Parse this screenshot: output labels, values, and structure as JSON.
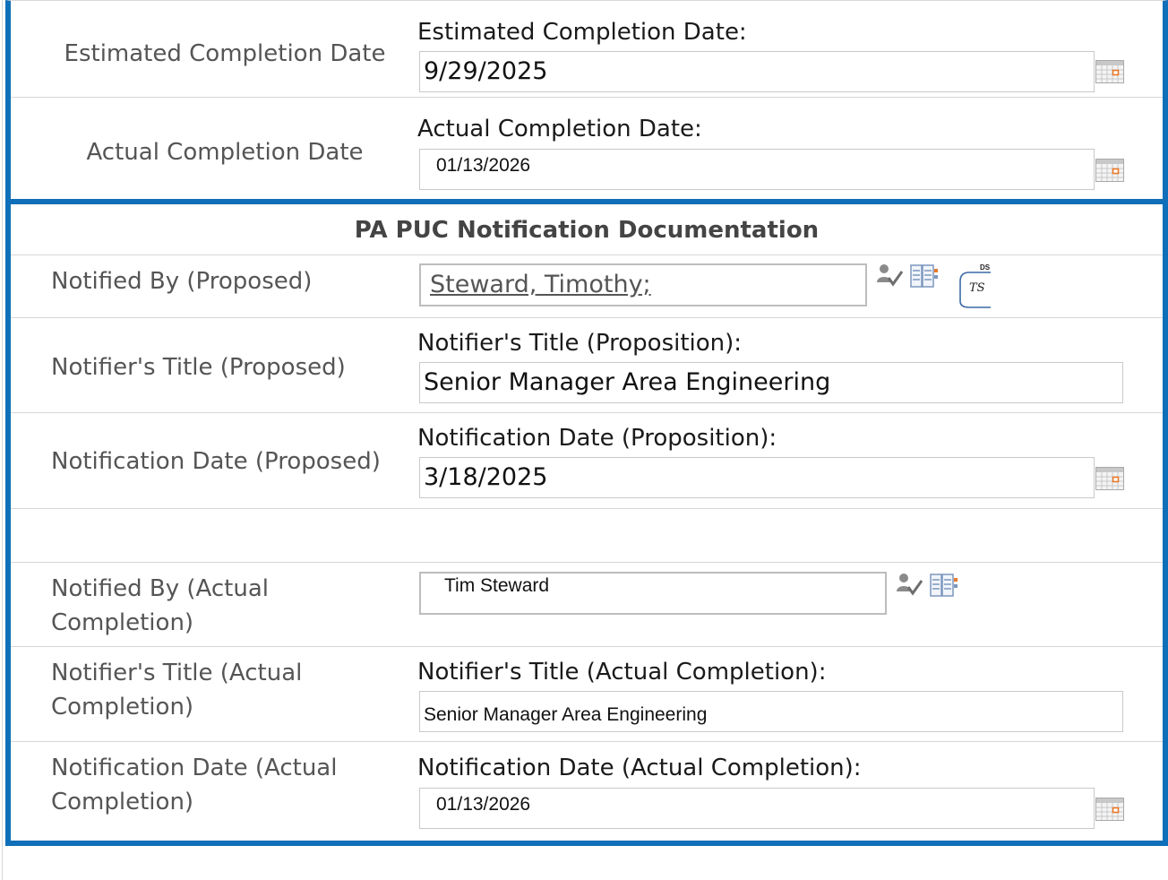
{
  "estimated": {
    "row_label": "Estimated Completion Date",
    "field_label": "Estimated Completion Date:",
    "value": "9/29/2025"
  },
  "actual": {
    "row_label": "Actual Completion Date",
    "field_label": "Actual Completion Date:",
    "value": "01/13/2026"
  },
  "notification": {
    "section_title": "PA PUC Notification Documentation",
    "notified_by_proposed": {
      "row_label": "Notified By (Proposed)",
      "value": "Steward, Timothy;",
      "badge_label": "DS",
      "badge_initials": "TS"
    },
    "title_proposed": {
      "row_label": "Notifier's Title (Proposed)",
      "field_label": "Notifier's Title (Proposition):",
      "value": "Senior Manager Area Engineering"
    },
    "date_proposed": {
      "row_label": "Notification Date (Proposed)",
      "field_label": "Notification Date (Proposition):",
      "value": "3/18/2025"
    },
    "notified_by_actual": {
      "row_label_line1": "Notified By (Actual",
      "row_label_line2": "Completion)",
      "value": "Tim Steward"
    },
    "title_actual": {
      "row_label_line1": "Notifier's Title (Actual",
      "row_label_line2": "Completion)",
      "field_label": "Notifier's Title (Actual Completion):",
      "value": "Senior Manager Area Engineering"
    },
    "date_actual": {
      "row_label_line1": "Notification Date (Actual",
      "row_label_line2": "Completion)",
      "field_label": "Notification Date (Actual Completion):",
      "value": "01/13/2026"
    }
  },
  "icons": {
    "calendar": "calendar-icon",
    "check_names": "check-names-icon",
    "address_book": "address-book-icon",
    "docusign": "docusign-badge"
  },
  "colors": {
    "section_border": "#0f6fb8",
    "calendar_accent": "#e8782a"
  }
}
